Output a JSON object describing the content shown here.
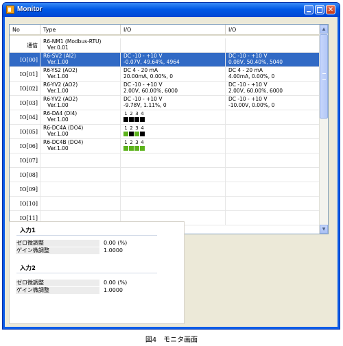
{
  "window": {
    "title": "Monitor"
  },
  "columns": {
    "no": "No",
    "type": "Type",
    "io1": "I/O",
    "io2": "I/O"
  },
  "rows": [
    {
      "no": "通信",
      "type1": "R6-NM1 (Modbus-RTU)",
      "type2": "Ver.0.01",
      "io1a": "",
      "io1b": "",
      "io2a": "",
      "io2b": ""
    },
    {
      "no": "IO[00]",
      "type1": "R6-SV2 (AI2)",
      "type2": "Ver.1.00",
      "io1a": "DC -10 - +10 V",
      "io1b": "-0.07V, 49.64%, 4964",
      "io2a": "DC -10 - +10 V",
      "io2b": "0.08V, 50.40%, 5040",
      "selected": true
    },
    {
      "no": "IO[01]",
      "type1": "R6-YS2 (AO2)",
      "type2": "Ver.1.00",
      "io1a": "DC 4 - 20 mA",
      "io1b": "20.00mA, 0.00%, 0",
      "io2a": "DC 4 - 20 mA",
      "io2b": "4.00mA, 0.00%, 0"
    },
    {
      "no": "IO[02]",
      "type1": "R6-YV2 (AO2)",
      "type2": "Ver.1.00",
      "io1a": "DC -10 - +10 V",
      "io1b": "2.00V, 60.00%, 6000",
      "io2a": "DC -10 - +10 V",
      "io2b": "2.00V, 60.00%, 6000"
    },
    {
      "no": "IO[03]",
      "type1": "R6-YV2 (AO2)",
      "type2": "Ver.1.00",
      "io1a": "DC -10 - +10 V",
      "io1b": "-9.78V, 1.11%, 0",
      "io2a": "DC -10 - +10 V",
      "io2b": "-10.00V, 0.00%, 0"
    },
    {
      "no": "IO[04]",
      "type1": "R6-DA4 (DI4)",
      "type2": "Ver.1.00",
      "bits": [
        "1",
        "2",
        "3",
        "4"
      ],
      "bitcolors": [
        "#000000",
        "#000000",
        "#000000",
        "#000000"
      ]
    },
    {
      "no": "IO[05]",
      "type1": "R6-DC4A (DO4)",
      "type2": "Ver.1.00",
      "bits": [
        "1",
        "2",
        "3",
        "4"
      ],
      "bitcolors": [
        "#5cb31c",
        "#000000",
        "#5cb31c",
        "#000000"
      ]
    },
    {
      "no": "IO[06]",
      "type1": "R6-DC4B (DO4)",
      "type2": "Ver.1.00",
      "bits": [
        "1",
        "2",
        "3",
        "4"
      ],
      "bitcolors": [
        "#5cb31c",
        "#5cb31c",
        "#5cb31c",
        "#5cb31c"
      ]
    },
    {
      "no": "IO[07]"
    },
    {
      "no": "IO[08]"
    },
    {
      "no": "IO[09]"
    },
    {
      "no": "IO[10]"
    },
    {
      "no": "IO[11]"
    }
  ],
  "sections": [
    {
      "title": "入力1",
      "params": [
        {
          "label": "ゼロ微調整",
          "value": "0.00 (%)"
        },
        {
          "label": "ゲイン微調整",
          "value": "1.0000"
        }
      ]
    },
    {
      "title": "入力2",
      "params": [
        {
          "label": "ゼロ微調整",
          "value": "0.00 (%)"
        },
        {
          "label": "ゲイン微調整",
          "value": "1.0000"
        }
      ]
    }
  ],
  "caption": "図4　モニタ画面",
  "colors": {
    "selection": "#316ac5",
    "on": "#5cb31c",
    "off": "#000000"
  },
  "icons": {
    "app": "app-icon",
    "minimize": "minimize-icon",
    "maximize": "maximize-icon",
    "close": "close-icon",
    "scroll_up": "arrow-up-icon",
    "scroll_down": "arrow-down-icon"
  }
}
